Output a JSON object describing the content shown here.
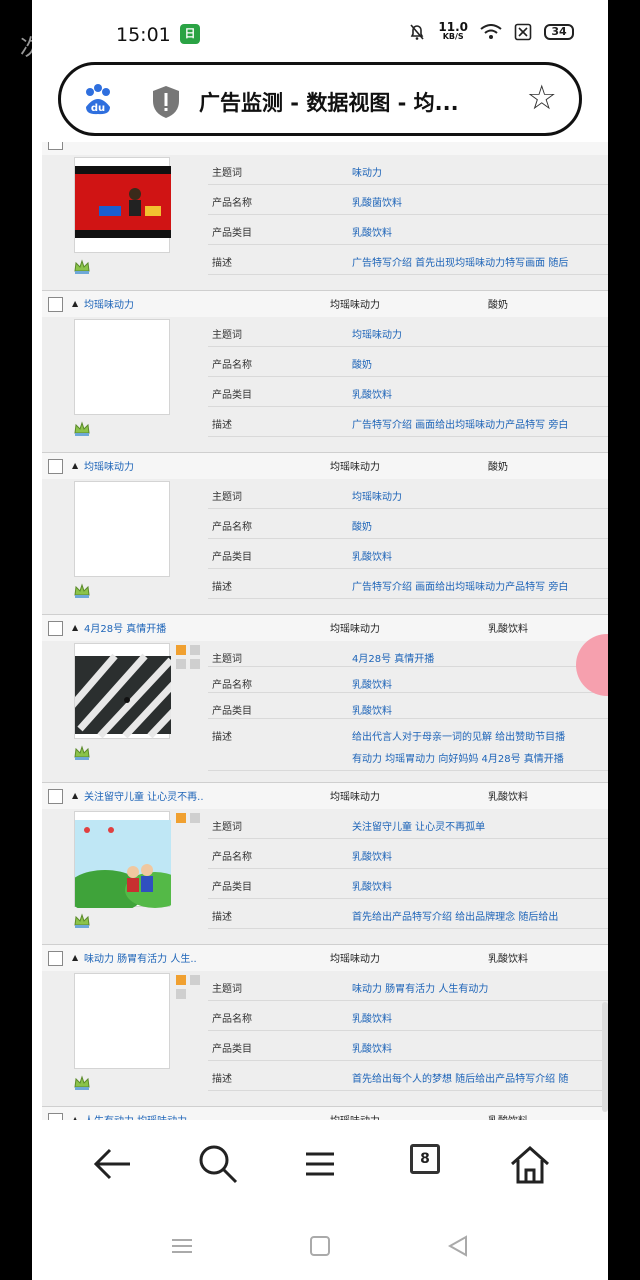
{
  "status_bar": {
    "time": "15:01",
    "app_badge": "日",
    "net_speed_value": "11.0",
    "net_speed_unit": "KB/S",
    "battery": "34",
    "watermark": "次元"
  },
  "address_bar": {
    "logo": "du",
    "title": "广告监测 - 数据视图 - 均..."
  },
  "records": [
    {
      "title": "",
      "col_a": "",
      "col_b": "",
      "thumb": "red-stage",
      "fields": [
        {
          "label": "主题词",
          "value": "味动力"
        },
        {
          "label": "产品名称",
          "value": "乳酸菌饮料"
        },
        {
          "label": "产品类目",
          "value": "乳酸饮料"
        },
        {
          "label": "描述",
          "value": "广告特写介绍 首先出现均瑶味动力特写画面 随后"
        }
      ]
    },
    {
      "title": "均瑶味动力",
      "col_a": "均瑶味动力",
      "col_b": "酸奶",
      "thumb": "blank",
      "fields": [
        {
          "label": "主题词",
          "value": "均瑶味动力"
        },
        {
          "label": "产品名称",
          "value": "酸奶"
        },
        {
          "label": "产品类目",
          "value": "乳酸饮料"
        },
        {
          "label": "描述",
          "value": "广告特写介绍 画面给出均瑶味动力产品特写 旁白"
        }
      ]
    },
    {
      "title": "均瑶味动力",
      "col_a": "均瑶味动力",
      "col_b": "酸奶",
      "thumb": "blank",
      "fields": [
        {
          "label": "主题词",
          "value": "均瑶味动力"
        },
        {
          "label": "产品名称",
          "value": "酸奶"
        },
        {
          "label": "产品类目",
          "value": "乳酸饮料"
        },
        {
          "label": "描述",
          "value": "广告特写介绍 画面给出均瑶味动力产品特写 旁白"
        }
      ]
    },
    {
      "title": "4月28号 真情开播",
      "col_a": "均瑶味动力",
      "col_b": "乳酸饮料",
      "thumb": "stripes",
      "fields": [
        {
          "label": "主题词",
          "value": "4月28号 真情开播"
        },
        {
          "label": "产品名称",
          "value": "乳酸饮料"
        },
        {
          "label": "产品类目",
          "value": "乳酸饮料"
        },
        {
          "label": "描述",
          "value": "给出代言人对于母亲一词的见解 给出赞助节目播",
          "value2": "有动力 均瑶胃动力 向好妈妈 4月28号 真情开播"
        }
      ]
    },
    {
      "title": "关注留守儿童 让心灵不再..",
      "col_a": "均瑶味动力",
      "col_b": "乳酸饮料",
      "thumb": "cartoon",
      "fields": [
        {
          "label": "主题词",
          "value": "关注留守儿童 让心灵不再孤单"
        },
        {
          "label": "产品名称",
          "value": "乳酸饮料"
        },
        {
          "label": "产品类目",
          "value": "乳酸饮料"
        },
        {
          "label": "描述",
          "value": "首先给出产品特写介绍 给出品牌理念 随后给出"
        }
      ]
    },
    {
      "title": "味动力 肠胃有活力 人生..",
      "col_a": "均瑶味动力",
      "col_b": "乳酸饮料",
      "thumb": "blank",
      "fields": [
        {
          "label": "主题词",
          "value": "味动力 肠胃有活力 人生有动力"
        },
        {
          "label": "产品名称",
          "value": "乳酸饮料"
        },
        {
          "label": "产品类目",
          "value": "乳酸饮料"
        },
        {
          "label": "描述",
          "value": "首先给出每个人的梦想 随后给出产品特写介绍 随"
        }
      ]
    },
    {
      "title": "人生有动力 均瑶味动力",
      "col_a": "均瑶味动力",
      "col_b": "乳酸饮料",
      "thumb": "blank",
      "fields": []
    }
  ],
  "bottom_nav": {
    "tab_count": "8"
  },
  "colors": {
    "link": "#1d64b8",
    "ball": "#f6a0ae",
    "tile_orange": "#f0a030"
  }
}
